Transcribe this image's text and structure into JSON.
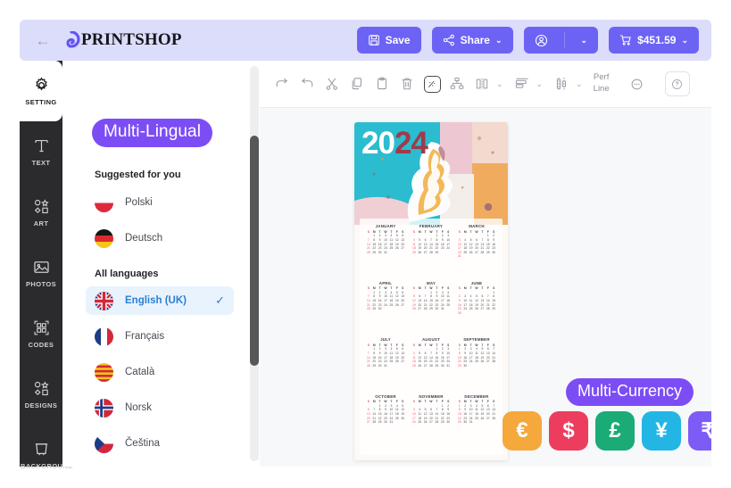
{
  "header": {
    "back_icon": "arrow-left-icon",
    "brand_icon": "printshop-logo-icon",
    "brand_name": "PRINTSHOP",
    "save": {
      "icon": "floppy-disk-icon",
      "label": "Save"
    },
    "share": {
      "icon": "share-nodes-icon",
      "label": "Share",
      "chevron": "⌄"
    },
    "account": {
      "icon": "user-circle-icon",
      "chevron": "⌄"
    },
    "cart": {
      "icon": "shopping-cart-icon",
      "label": "$451.59",
      "chevron": "⌄"
    },
    "accent_color": "#6c63f5",
    "bar_color": "#dcdcfb"
  },
  "rail": {
    "items": [
      {
        "icon": "gear-icon",
        "label": "SETTING",
        "active": true
      },
      {
        "icon": "text-t-icon",
        "label": "TEXT",
        "active": false
      },
      {
        "icon": "shapes-icon",
        "label": "ART",
        "active": false
      },
      {
        "icon": "image-icon",
        "label": "PHOTOS",
        "active": false
      },
      {
        "icon": "qr-code-icon",
        "label": "CODES",
        "active": false
      },
      {
        "icon": "shapes-icon",
        "label": "DESIGNS",
        "active": false
      },
      {
        "icon": "background-icon",
        "label": "BACKGROUND",
        "active": false
      }
    ]
  },
  "panel": {
    "badge": "Multi-Lingual",
    "badge_color": "#7c4df5",
    "suggested_title": "Suggested for you",
    "all_title": "All languages",
    "suggested": [
      {
        "flag": "flag-poland-icon",
        "label": "Polski"
      },
      {
        "flag": "flag-germany-icon",
        "label": "Deutsch"
      }
    ],
    "all": [
      {
        "flag": "flag-uk-icon",
        "label": "English (UK)",
        "selected": true,
        "check": "✓"
      },
      {
        "flag": "flag-france-icon",
        "label": "Français",
        "selected": false
      },
      {
        "flag": "flag-catalonia-icon",
        "label": "Català",
        "selected": false
      },
      {
        "flag": "flag-norway-icon",
        "label": "Norsk",
        "selected": false
      },
      {
        "flag": "flag-czech-icon",
        "label": "Čeština",
        "selected": false
      }
    ]
  },
  "toolbar": {
    "items": [
      {
        "icon": "redo-icon",
        "type": "icon"
      },
      {
        "icon": "undo-icon",
        "type": "icon"
      },
      {
        "icon": "scissors-icon",
        "type": "icon"
      },
      {
        "icon": "copy-icon",
        "type": "icon"
      },
      {
        "icon": "paste-icon",
        "type": "icon"
      },
      {
        "icon": "trash-icon",
        "type": "icon"
      },
      {
        "icon": "crop-fill-icon",
        "type": "boxed"
      },
      {
        "icon": "group-icon",
        "type": "icon"
      },
      {
        "icon": "align-horizontal-icon",
        "type": "icon",
        "chevron": "⌄"
      },
      {
        "icon": "align-distribute-icon",
        "type": "icon",
        "chevron": "⌄"
      },
      {
        "icon": "align-vertical-icon",
        "type": "icon",
        "chevron": "⌄"
      }
    ],
    "perf_line": "Perf\nLine",
    "perf_line_1": "Perf",
    "perf_line_2": "Line",
    "more_icon": "more-horizontal-icon",
    "help_icon": "help-circle-icon"
  },
  "canvas": {
    "poster": {
      "year_first": "20",
      "year_second": "24",
      "art_description": "ice-cream-swirl-artwork",
      "months": [
        {
          "name": "JANUARY",
          "first_weekday": 1,
          "days": 31
        },
        {
          "name": "FEBRUARY",
          "first_weekday": 4,
          "days": 29
        },
        {
          "name": "MARCH",
          "first_weekday": 5,
          "days": 31
        },
        {
          "name": "APRIL",
          "first_weekday": 1,
          "days": 30
        },
        {
          "name": "MAY",
          "first_weekday": 3,
          "days": 31
        },
        {
          "name": "JUNE",
          "first_weekday": 6,
          "days": 30
        },
        {
          "name": "JULY",
          "first_weekday": 1,
          "days": 31
        },
        {
          "name": "AUGUST",
          "first_weekday": 4,
          "days": 31
        },
        {
          "name": "SEPTEMBER",
          "first_weekday": 0,
          "days": 30
        },
        {
          "name": "OCTOBER",
          "first_weekday": 2,
          "days": 31
        },
        {
          "name": "NOVEMBER",
          "first_weekday": 5,
          "days": 30
        },
        {
          "name": "DECEMBER",
          "first_weekday": 0,
          "days": 31
        }
      ],
      "weekday_headers": [
        "S",
        "M",
        "T",
        "W",
        "T",
        "F",
        "S"
      ]
    },
    "currency_badge": "Multi-Currency",
    "currencies": [
      {
        "symbol": "€",
        "name": "euro-chip",
        "color": "#f5a83c"
      },
      {
        "symbol": "$",
        "name": "dollar-chip",
        "color": "#ec3d5e"
      },
      {
        "symbol": "£",
        "name": "pound-chip",
        "color": "#1bab77"
      },
      {
        "symbol": "¥",
        "name": "yen-chip",
        "color": "#23b6e5"
      },
      {
        "symbol": "₹",
        "name": "indian-rupee-chip",
        "color": "#7d5cf6"
      }
    ]
  }
}
